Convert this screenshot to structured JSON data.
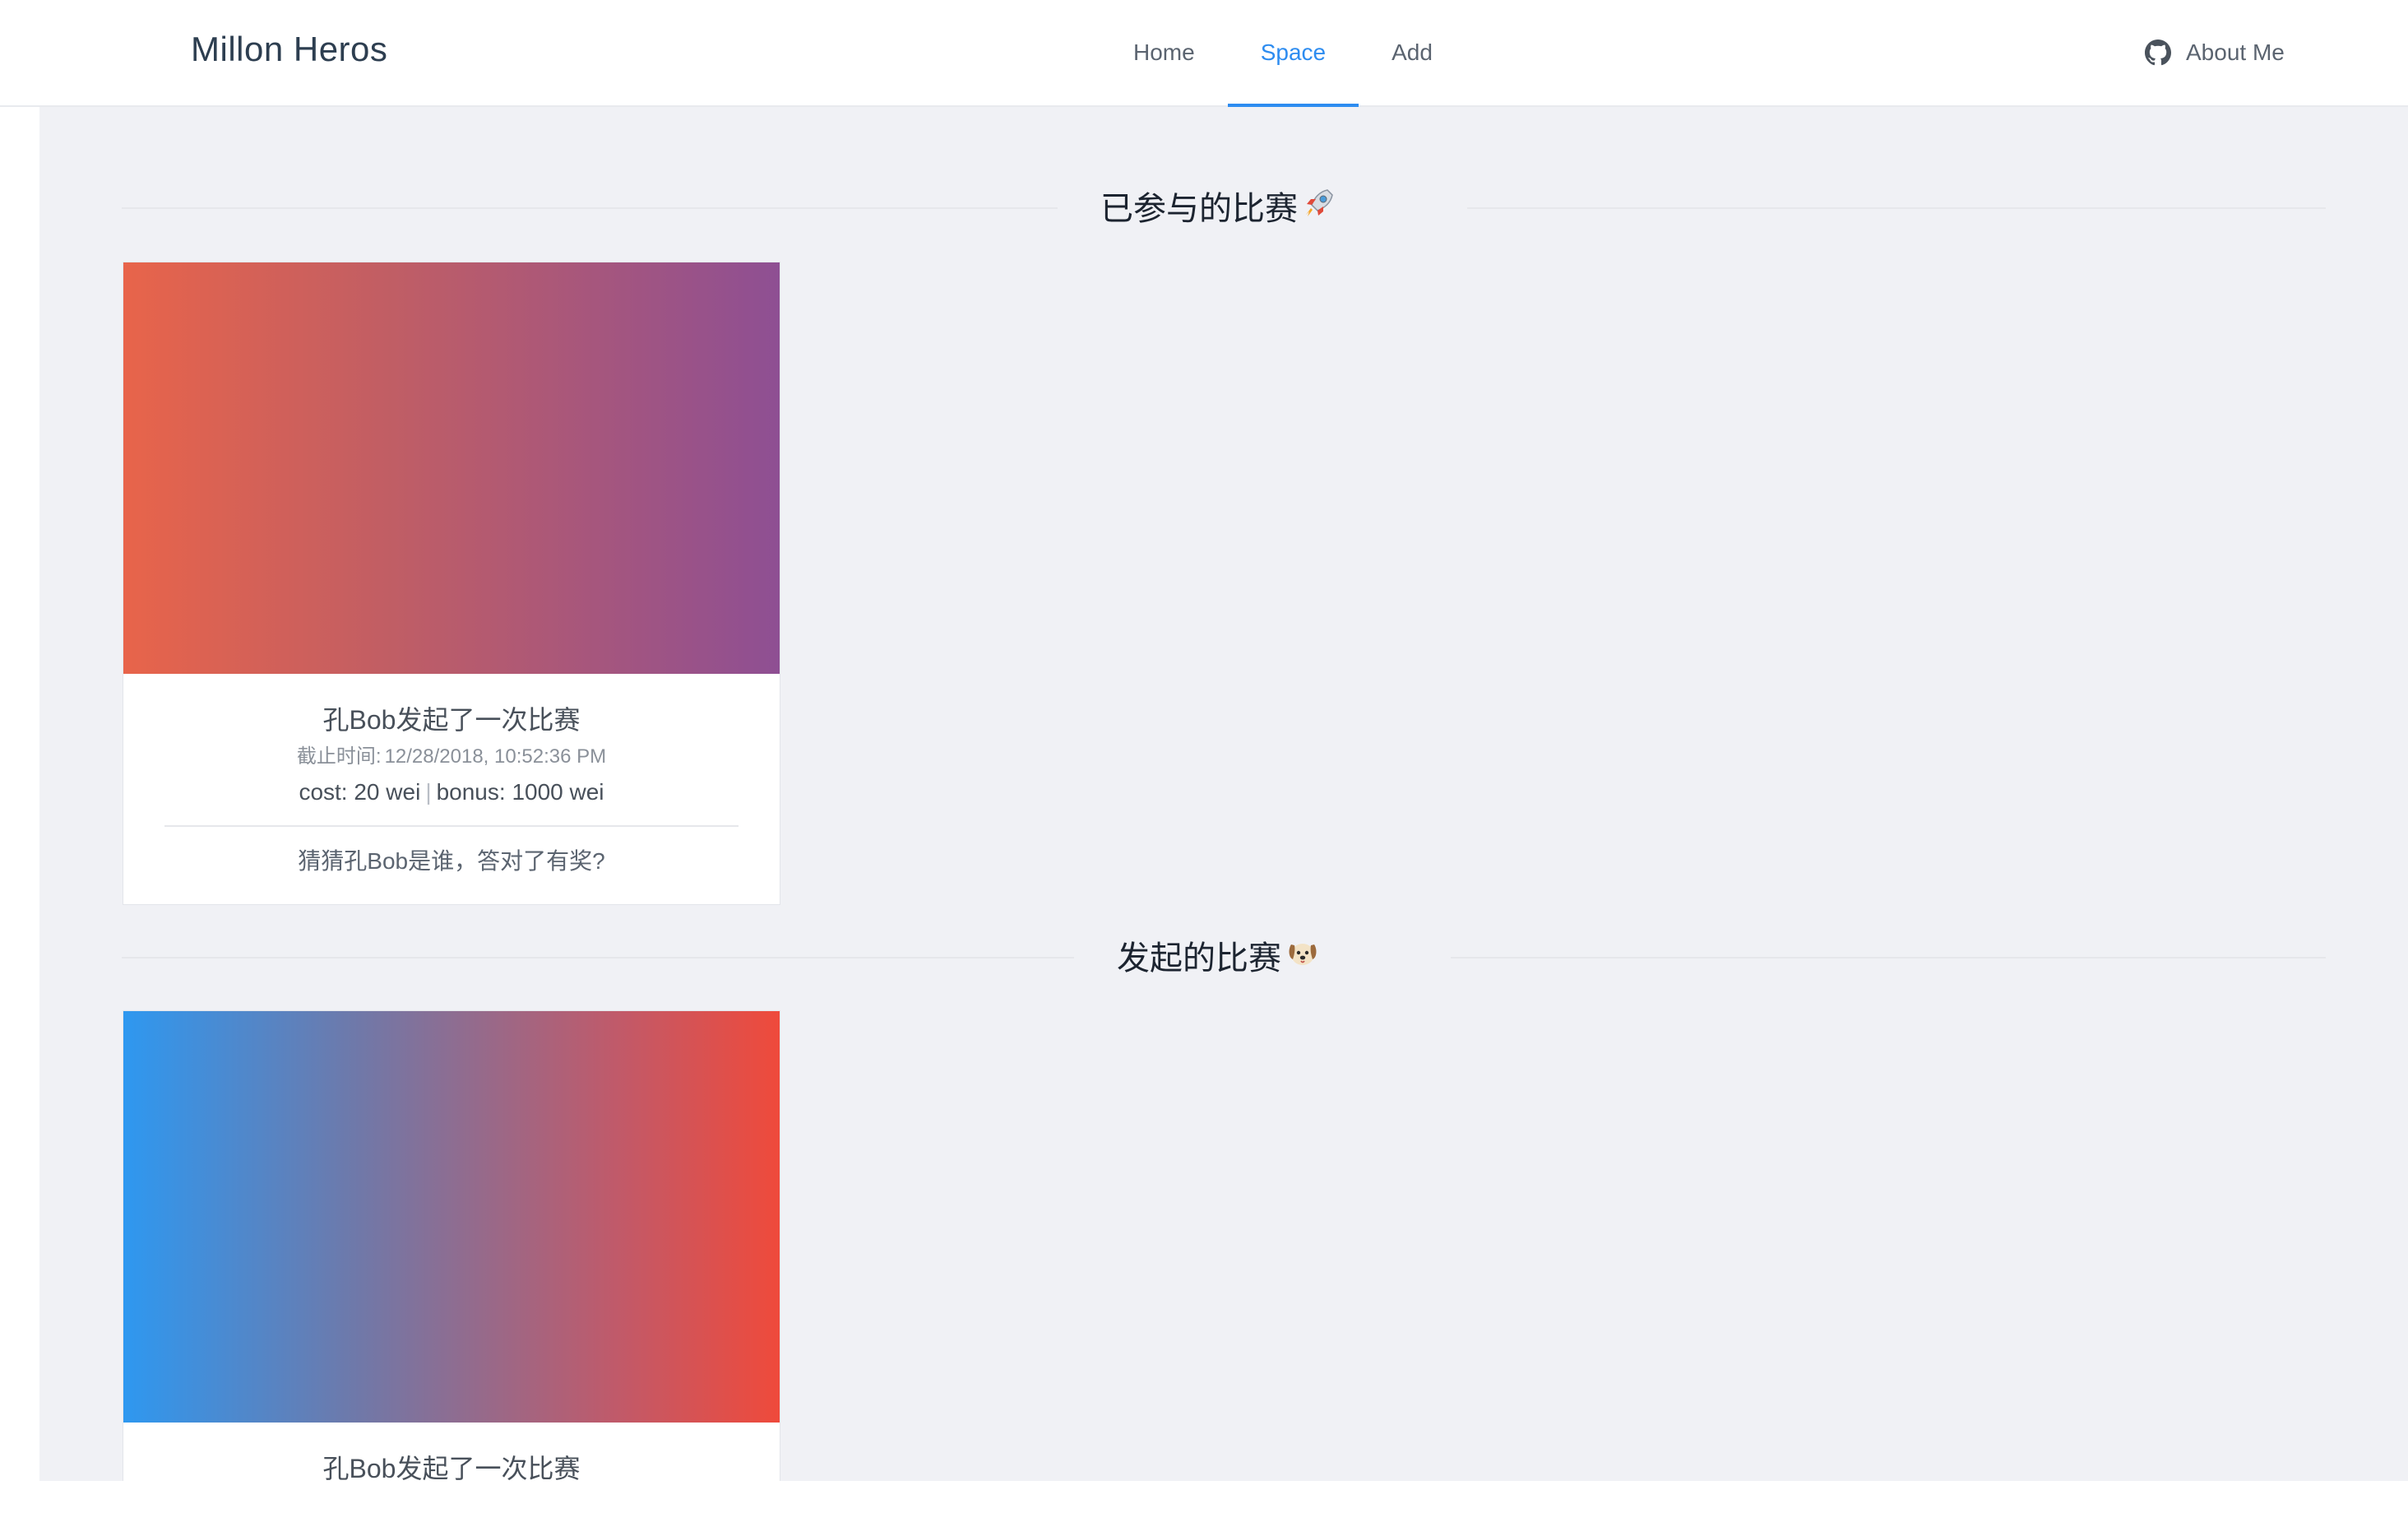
{
  "header": {
    "brand": "Millon Heros",
    "nav": [
      {
        "label": "Home",
        "active": false
      },
      {
        "label": "Space",
        "active": true
      },
      {
        "label": "Add",
        "active": false
      }
    ],
    "about_label": "About Me",
    "about_icon": "github-icon",
    "accent_color": "#2d8cf0"
  },
  "sections": {
    "joined": {
      "title": "已参与的比赛",
      "emoji": "rocket-icon",
      "card": {
        "title": "孔Bob发起了一次比赛",
        "deadline_label": "截止时间:",
        "deadline_value": "12/28/2018, 10:52:36 PM",
        "cost": "cost: 20 wei",
        "separator": "|",
        "bonus": "bonus: 1000 wei",
        "description": "猜猜孔Bob是谁，答对了有奖?"
      }
    },
    "created": {
      "title": "发起的比赛",
      "emoji": "dog-face-icon",
      "card": {
        "title": "孔Bob发起了一次比赛"
      }
    }
  }
}
